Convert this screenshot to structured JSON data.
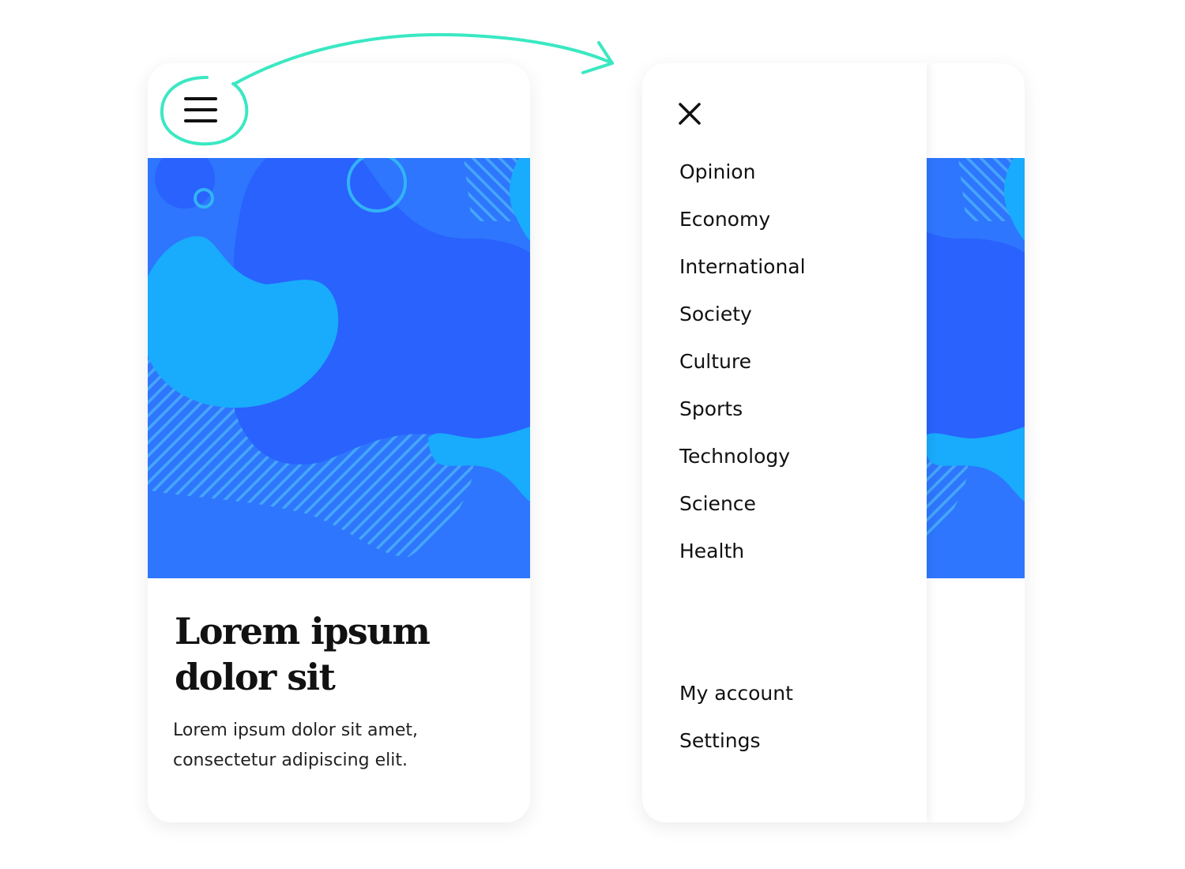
{
  "colors": {
    "accent_annotation": "#3ae8c2",
    "image_background": "#2e76fd",
    "image_blob_dark": "#2962fd",
    "image_blob_light": "#19abfc",
    "image_stripes": "#46a7f9"
  },
  "closed_state": {
    "menu_icon": "hamburger-icon",
    "article": {
      "title": "Lorem ipsum\ndolor sit",
      "description": "Lorem ipsum dolor sit amet, consectetur adipiscing elit."
    }
  },
  "open_state": {
    "close_icon": "close-icon",
    "menu_items": [
      {
        "label": "Opinion"
      },
      {
        "label": "Economy"
      },
      {
        "label": "International"
      },
      {
        "label": "Society"
      },
      {
        "label": "Culture"
      },
      {
        "label": "Sports"
      },
      {
        "label": "Technology"
      },
      {
        "label": "Science"
      },
      {
        "label": "Health"
      }
    ],
    "account_items": [
      {
        "label": "My account"
      },
      {
        "label": "Settings"
      }
    ]
  },
  "annotation": {
    "arrow_icon": "curved-arrow-icon",
    "highlight_icon": "hand-drawn-circle-icon"
  }
}
